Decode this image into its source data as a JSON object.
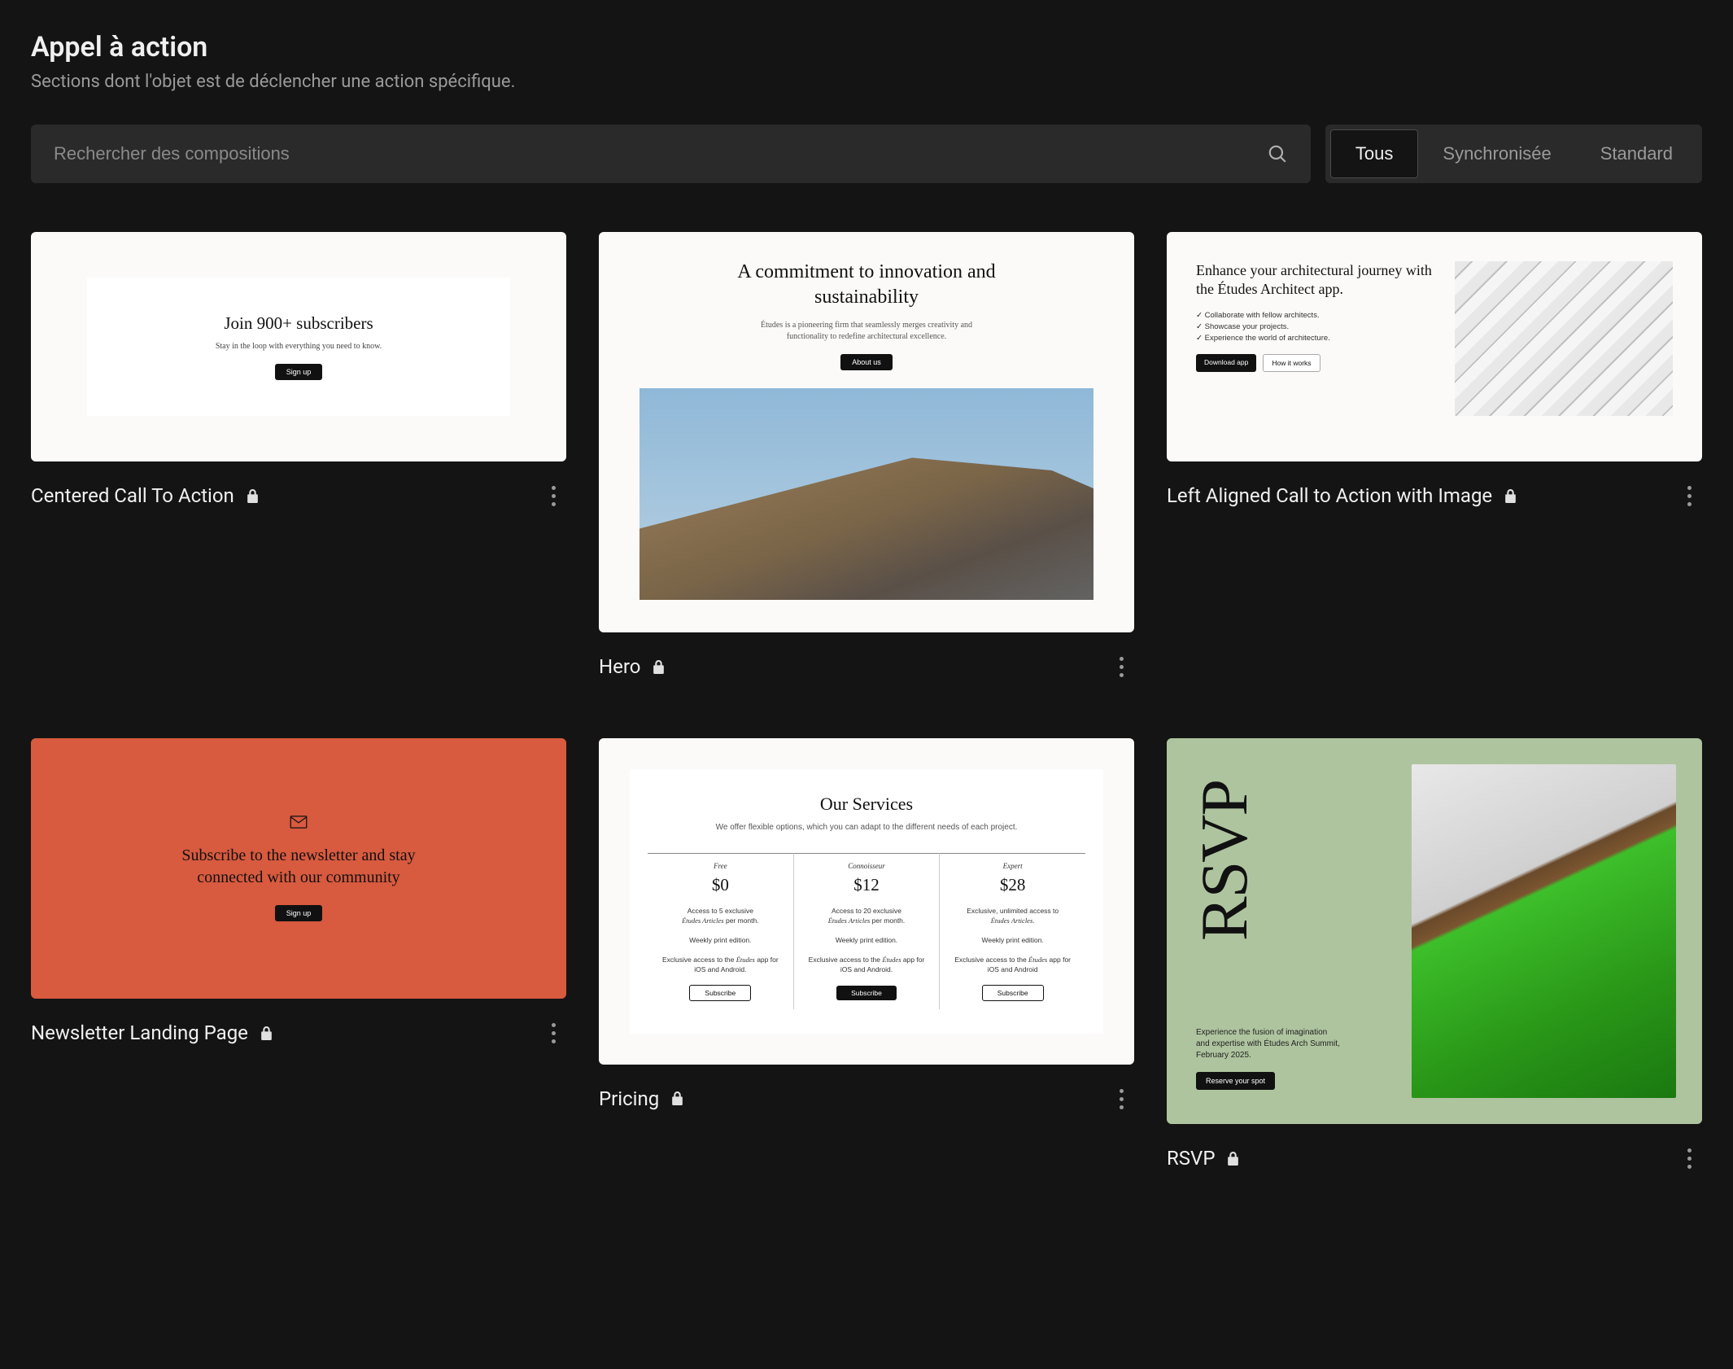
{
  "header": {
    "title": "Appel à action",
    "subtitle": "Sections dont l'objet est de déclencher une action spécifique."
  },
  "search": {
    "placeholder": "Rechercher des compositions"
  },
  "filters": {
    "tabs": [
      "Tous",
      "Synchronisée",
      "Standard"
    ],
    "active_index": 0
  },
  "cards": [
    {
      "title": "Centered Call To Action",
      "locked": true,
      "thumb": {
        "heading": "Join 900+ subscribers",
        "sub": "Stay in the loop with everything you need to know.",
        "button": "Sign up"
      }
    },
    {
      "title": "Hero",
      "locked": true,
      "thumb": {
        "heading": "A commitment to innovation and sustainability",
        "sub": "Études is a pioneering firm that seamlessly merges creativity and functionality to redefine architectural excellence.",
        "button": "About us"
      }
    },
    {
      "title": "Left Aligned Call to Action with Image",
      "locked": true,
      "thumb": {
        "heading": "Enhance your architectural journey with the Études Architect app.",
        "bullets": [
          "Collaborate with fellow architects.",
          "Showcase your projects.",
          "Experience the world of architecture."
        ],
        "button1": "Download app",
        "button2": "How it works"
      }
    },
    {
      "title": "Newsletter Landing Page",
      "locked": true,
      "thumb": {
        "heading": "Subscribe to the newsletter and stay connected with our community",
        "button": "Sign up"
      }
    },
    {
      "title": "Pricing",
      "locked": true,
      "thumb": {
        "heading": "Our Services",
        "sub": "We offer flexible options, which you can adapt to the different needs of each project.",
        "tiers": [
          {
            "name": "Free",
            "price": "$0",
            "f1": "Access to 5 exclusive",
            "f1em": "Études Articles",
            "f1s": " per month.",
            "f2": "Weekly print edition.",
            "f3": "Exclusive access to the ",
            "f3em": "Études",
            "f3s": " app for iOS and Android.",
            "btn": "Subscribe",
            "style": "outline"
          },
          {
            "name": "Connoisseur",
            "price": "$12",
            "f1": "Access to 20 exclusive",
            "f1em": "Études Articles",
            "f1s": " per month.",
            "f2": "Weekly print edition.",
            "f3": "Exclusive access to the ",
            "f3em": "Études",
            "f3s": " app for iOS and Android.",
            "btn": "Subscribe",
            "style": "solid"
          },
          {
            "name": "Expert",
            "price": "$28",
            "f1": "Exclusive, unlimited access to ",
            "f1em": "Études Articles",
            "f1s": ".",
            "f2": "Weekly print edition.",
            "f3": "Exclusive access to the ",
            "f3em": "Études",
            "f3s": " app for iOS and Android",
            "btn": "Subscribe",
            "style": "outline"
          }
        ]
      }
    },
    {
      "title": "RSVP",
      "locked": true,
      "thumb": {
        "heading": "RSVP",
        "sub": "Experience the fusion of imagination and expertise with Études Arch Summit, February 2025.",
        "button": "Reserve your spot"
      }
    }
  ]
}
